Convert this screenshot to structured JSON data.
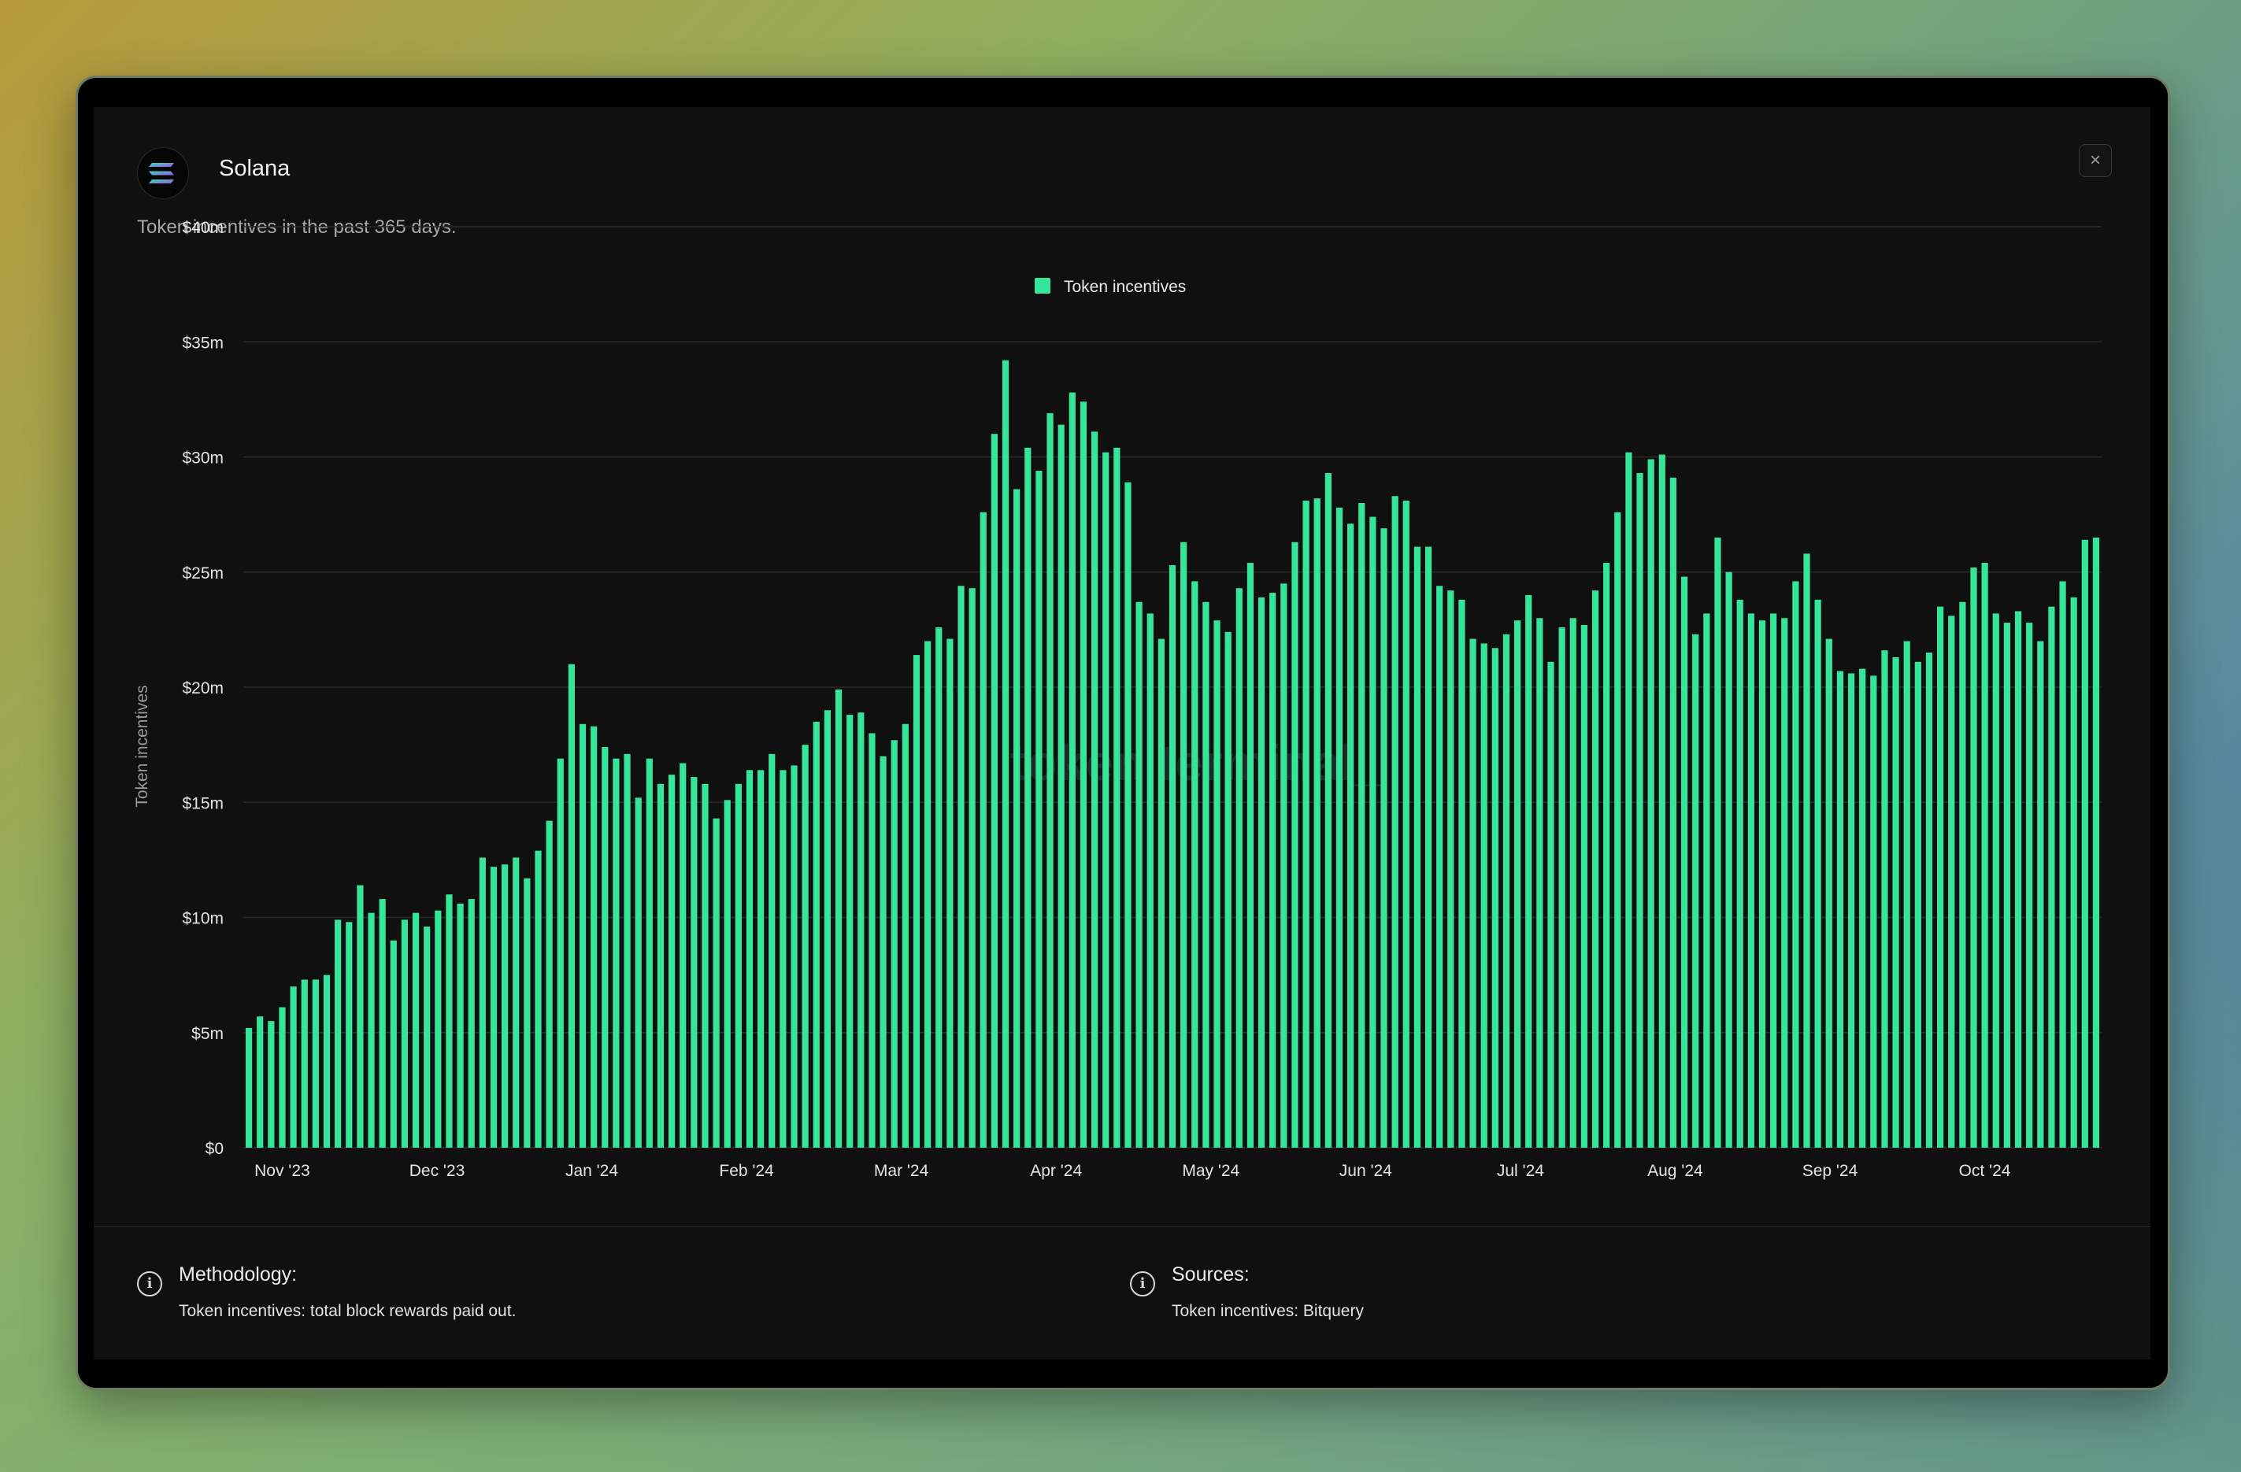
{
  "header": {
    "title": "Solana",
    "subtitle": "Token incentives in the past 365 days.",
    "logo_icon": "solana-logo",
    "close_icon": "close-icon",
    "close_glyph": "×"
  },
  "watermark": "token terminal_",
  "footer": {
    "methodology": {
      "icon": "info-icon",
      "title": "Methodology:",
      "text": "Token incentives: total block rewards paid out."
    },
    "sources": {
      "icon": "info-icon",
      "title": "Sources:",
      "text": "Token incentives: Bitquery"
    }
  },
  "colors": {
    "bar": "#35e69a",
    "background": "#101010",
    "grid": "#2a2a2a"
  },
  "chart_data": {
    "type": "bar",
    "ylabel": "Token incentives",
    "ylim": [
      0,
      40
    ],
    "y_unit": "$m",
    "y_ticks": [
      "$0",
      "$5m",
      "$10m",
      "$15m",
      "$20m",
      "$25m",
      "$30m",
      "$35m",
      "$40m"
    ],
    "x_ticks": [
      "Nov '23",
      "Dec '23",
      "Jan '24",
      "Feb '24",
      "Mar '24",
      "Apr '24",
      "May '24",
      "Jun '24",
      "Jul '24",
      "Aug '24",
      "Sep '24",
      "Oct '24"
    ],
    "legend": "top-center",
    "grid": true,
    "series": [
      {
        "name": "Token incentives",
        "color": "#35e69a",
        "values": [
          5.2,
          5.7,
          5.5,
          6.1,
          7.0,
          7.3,
          7.3,
          7.5,
          9.9,
          9.8,
          11.4,
          10.2,
          10.8,
          9.0,
          9.9,
          10.2,
          9.6,
          10.3,
          11.0,
          10.6,
          10.8,
          12.6,
          12.2,
          12.3,
          12.6,
          11.7,
          12.9,
          14.2,
          16.9,
          21.0,
          18.4,
          18.3,
          17.4,
          16.9,
          17.1,
          15.2,
          16.9,
          15.8,
          16.2,
          16.7,
          16.1,
          15.8,
          14.3,
          15.1,
          15.8,
          16.4,
          16.4,
          17.1,
          16.4,
          16.6,
          17.5,
          18.5,
          19.0,
          19.9,
          18.8,
          18.9,
          18.0,
          17.0,
          17.7,
          18.4,
          21.4,
          22.0,
          22.6,
          22.1,
          24.4,
          24.3,
          27.6,
          31.0,
          34.2,
          28.6,
          30.4,
          29.4,
          31.9,
          31.4,
          32.8,
          32.4,
          31.1,
          30.2,
          30.4,
          28.9,
          23.7,
          23.2,
          22.1,
          25.3,
          26.3,
          24.6,
          23.7,
          22.9,
          22.4,
          24.3,
          25.4,
          23.9,
          24.1,
          24.5,
          26.3,
          28.1,
          28.2,
          29.3,
          27.8,
          27.1,
          28.0,
          27.4,
          26.9,
          28.3,
          28.1,
          26.1,
          26.1,
          24.4,
          24.2,
          23.8,
          22.1,
          21.9,
          21.7,
          22.3,
          22.9,
          24.0,
          23.0,
          21.1,
          22.6,
          23.0,
          22.7,
          24.2,
          25.4,
          27.6,
          30.2,
          29.3,
          29.9,
          30.1,
          29.1,
          24.8,
          22.3,
          23.2,
          26.5,
          25.0,
          23.8,
          23.2,
          22.9,
          23.2,
          23.0,
          24.6,
          25.8,
          23.8,
          22.1,
          20.7,
          20.6,
          20.8,
          20.5,
          21.6,
          21.3,
          22.0,
          21.1,
          21.5,
          23.5,
          23.1,
          23.7,
          25.2,
          25.4,
          23.2,
          22.8,
          23.3,
          22.8,
          22.0,
          23.5,
          24.6,
          23.9,
          26.4,
          26.5
        ]
      }
    ]
  }
}
